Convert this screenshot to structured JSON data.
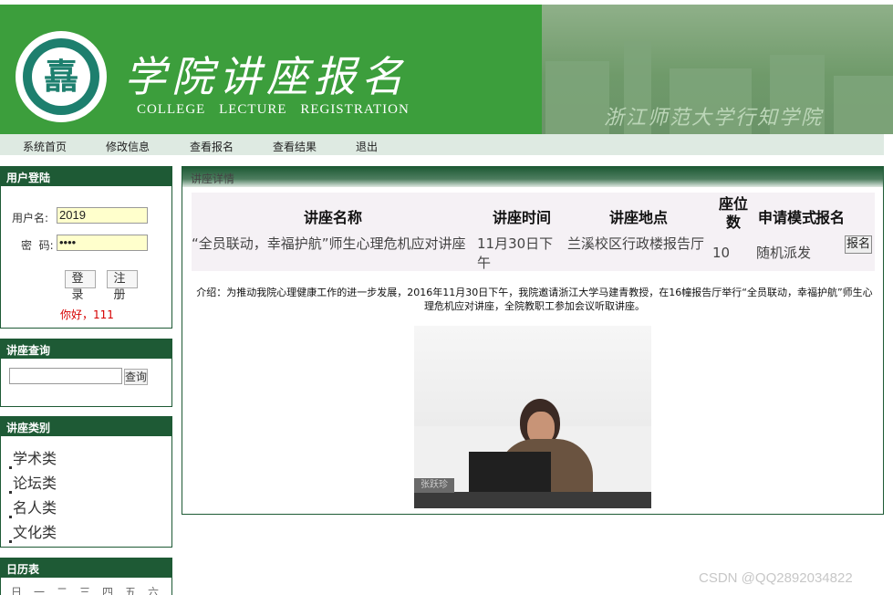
{
  "banner": {
    "title": "学院讲座报名",
    "subtitle": "COLLEGE LECTURE REGISTRATION",
    "logo_glyph": "嚞",
    "photo_caption": "浙江师范大学行知学院",
    "colors": {
      "banner_green": "#3c9e3c",
      "panel_green": "#1e5a35",
      "nav_bg": "#deeae2"
    }
  },
  "topnav": {
    "items": [
      "系统首页",
      "修改信息",
      "查看报名",
      "查看结果",
      "退出"
    ]
  },
  "login": {
    "header": "用户登陆",
    "username_label": "用户名:",
    "username_value": "2019",
    "password_label": "密  码:",
    "password_value": "••••",
    "login_button": "登录",
    "register_button": "注册",
    "greeting": "你好，111"
  },
  "search": {
    "header": "讲座查询",
    "button": "查询"
  },
  "categories": {
    "header": "讲座类别",
    "items": [
      "学术类",
      "论坛类",
      "名人类",
      "文化类"
    ]
  },
  "calendar": {
    "header": "日历表",
    "weekdays": [
      "日",
      "一",
      "二",
      "三",
      "四",
      "五",
      "六"
    ]
  },
  "detail": {
    "header": "讲座详情",
    "columns": [
      "讲座名称",
      "讲座时间",
      "讲座地点",
      "座位数",
      "申请模式",
      "报名"
    ],
    "row": {
      "name": "“全员联动，幸福护航”师生心理危机应对讲座",
      "time": "11月30日下午",
      "location": "兰溪校区行政楼报告厅",
      "seats": "10",
      "mode": "随机派发",
      "apply_button": "报名"
    },
    "intro": "介绍：为推动我院心理健康工作的进一步发展，2016年11月30日下午，我院邀请浙江大学马建青教授，在16幢报告厅举行“全员联动，幸福护航”师生心理危机应对讲座，全院教职工参加会议听取讲座。",
    "photo_nameplate": "张跃珍"
  },
  "watermark": "CSDN @QQ2892034822"
}
